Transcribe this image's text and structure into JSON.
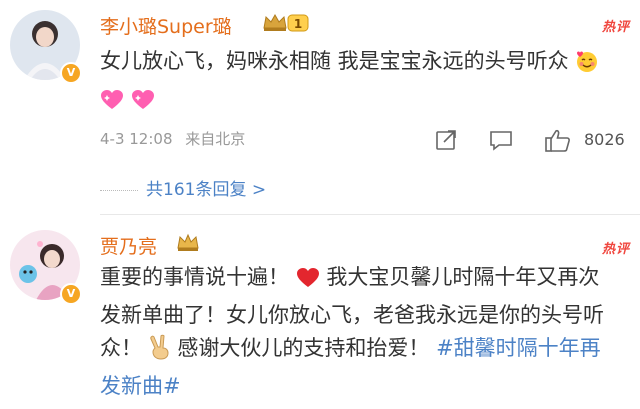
{
  "comments": [
    {
      "username": "李小璐Super璐",
      "crown_level": "1",
      "hot_label": "热评",
      "text": "女儿放心飞，妈咪永相随 我是宝宝永远的头号听众",
      "emojis": [
        "smiling-face-with-hearts-emoji",
        "sparkling-heart-emoji",
        "sparkling-heart-emoji"
      ],
      "timestamp": "4-3 12:08",
      "source": "来自北京",
      "like_count": "8026",
      "replies_label": "共161条回复 >"
    },
    {
      "username": "贾乃亮",
      "hot_label": "热评",
      "text_part1": "重要的事情说十遍！",
      "text_part2": "我大宝贝馨儿时隔十年又再次发新单曲了！女儿你放心飞，老爸我永远是你的头号听众！",
      "text_part3": "感谢大伙儿的支持和抬爱！",
      "hashtag": "#甜馨时隔十年再发新曲#",
      "emojis": [
        "red-heart-emoji",
        "victory-hand-emoji"
      ]
    }
  ],
  "colors": {
    "username": "#e46e1c",
    "hot": "#f0473f",
    "link": "#4c82c6",
    "meta": "#999999"
  }
}
